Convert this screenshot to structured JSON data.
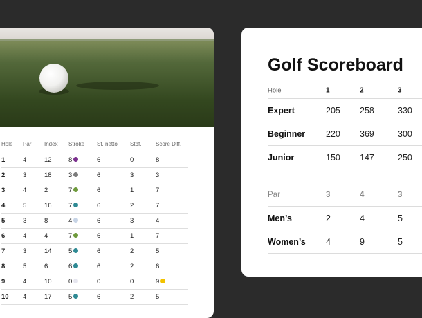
{
  "scorecard": {
    "columns": [
      "Hole",
      "Par",
      "Index",
      "Stroke",
      "St. netto",
      "Stbf.",
      "Score Diff."
    ],
    "rows": [
      {
        "hole": "1",
        "par": "4",
        "index": "12",
        "stroke": "8",
        "stroke_dot": "#7b2f8e",
        "netto": "6",
        "stbf": "0",
        "diff": "8",
        "diff_dot": ""
      },
      {
        "hole": "2",
        "par": "3",
        "index": "18",
        "stroke": "3",
        "stroke_dot": "#7b7b7b",
        "netto": "6",
        "stbf": "3",
        "diff": "3",
        "diff_dot": ""
      },
      {
        "hole": "3",
        "par": "4",
        "index": "2",
        "stroke": "7",
        "stroke_dot": "#6e9a3c",
        "netto": "6",
        "stbf": "1",
        "diff": "7",
        "diff_dot": ""
      },
      {
        "hole": "4",
        "par": "5",
        "index": "16",
        "stroke": "7",
        "stroke_dot": "#2f8a94",
        "netto": "6",
        "stbf": "2",
        "diff": "7",
        "diff_dot": ""
      },
      {
        "hole": "5",
        "par": "3",
        "index": "8",
        "stroke": "4",
        "stroke_dot": "#c7d4e6",
        "netto": "6",
        "stbf": "3",
        "diff": "4",
        "diff_dot": ""
      },
      {
        "hole": "6",
        "par": "4",
        "index": "4",
        "stroke": "7",
        "stroke_dot": "#6e9a3c",
        "netto": "6",
        "stbf": "1",
        "diff": "7",
        "diff_dot": ""
      },
      {
        "hole": "7",
        "par": "3",
        "index": "14",
        "stroke": "5",
        "stroke_dot": "#2f8a94",
        "netto": "6",
        "stbf": "2",
        "diff": "5",
        "diff_dot": ""
      },
      {
        "hole": "8",
        "par": "5",
        "index": "6",
        "stroke": "6",
        "stroke_dot": "#2f8a94",
        "netto": "6",
        "stbf": "2",
        "diff": "6",
        "diff_dot": ""
      },
      {
        "hole": "9",
        "par": "4",
        "index": "10",
        "stroke": "0",
        "stroke_dot": "#e6e6ef",
        "netto": "0",
        "stbf": "0",
        "diff": "9",
        "diff_dot": "#f2c200"
      },
      {
        "hole": "10",
        "par": "4",
        "index": "17",
        "stroke": "5",
        "stroke_dot": "#2f8a94",
        "netto": "6",
        "stbf": "2",
        "diff": "5",
        "diff_dot": ""
      }
    ]
  },
  "scoreboard": {
    "title": "Golf Scoreboard",
    "hole_label": "Hole",
    "holes": [
      "1",
      "2",
      "3"
    ],
    "distances": [
      {
        "label": "Expert",
        "values": [
          "205",
          "258",
          "330"
        ]
      },
      {
        "label": "Beginner",
        "values": [
          "220",
          "369",
          "300"
        ]
      },
      {
        "label": "Junior",
        "values": [
          "150",
          "147",
          "250"
        ]
      }
    ],
    "par_label": "Par",
    "pars": [
      "3",
      "4",
      "3"
    ],
    "par_rows": [
      {
        "label": "Men’s",
        "values": [
          "2",
          "4",
          "5"
        ]
      },
      {
        "label": "Women’s",
        "values": [
          "4",
          "9",
          "5"
        ]
      }
    ]
  }
}
